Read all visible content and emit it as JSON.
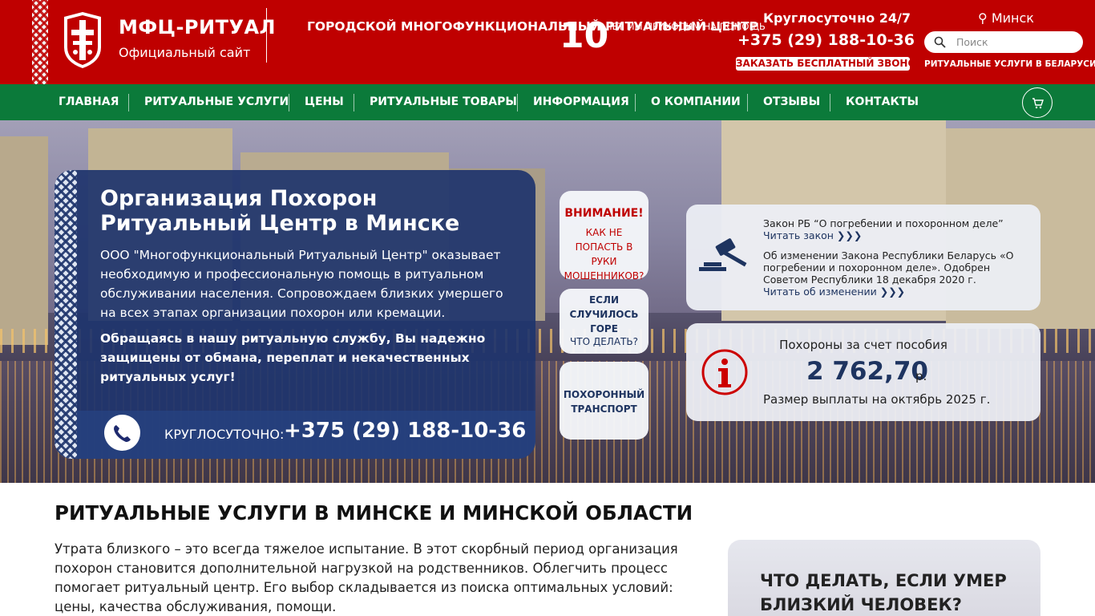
{
  "header": {
    "brand": "МФЦ-РИТУАЛ",
    "brand_sub": "Официальный сайт",
    "center_name": "ГОРОДСКОЙ МНОГОФУНКЦИОНАЛЬНЫЙ РИТУАЛЬНЫЙ ЦЕНТР",
    "years_num": "10",
    "years_text": "ЛЕТ МЫ ПРИХОДИМ НА ПОМОЩЬ",
    "hours": "Круглосуточно 24/7",
    "phone": "+375 (29) 188-10-36",
    "callback": "ЗАКАЗАТЬ БЕСПЛАТНЫЙ ЗВОНОК",
    "city": "Минск",
    "search_placeholder": "Поиск",
    "tagline": "РИТУАЛЬНЫЕ УСЛУГИ В БЕЛАРУСИ"
  },
  "nav": {
    "items": [
      "ГЛАВНАЯ",
      "РИТУАЛЬНЫЕ УСЛУГИ",
      "ЦЕНЫ",
      "РИТУАЛЬНЫЕ ТОВАРЫ",
      "ИНФОРМАЦИЯ",
      "О КОМПАНИИ",
      "ОТЗЫВЫ",
      "КОНТАКТЫ"
    ]
  },
  "hero": {
    "title": "Организация Похорон Ритуальный Центр в Минске",
    "p1": "ООО \"Многофункциональный Ритуальный Центр\" оказывает необходимую и профессиональную помощь в ритуальном обслуживании населения. Сопровождаем близких умершего на всех этапах организации похорон или кремации.",
    "p2": "Обращаясь в нашу ритуальную службу, Вы надежно защищены от обмана, переплат и некачественных ритуальных услуг!",
    "phone_label": "КРУГЛОСУТОЧНО:",
    "phone": "+375 (29) 188-10-36"
  },
  "tiles": {
    "t1_title": "ВНИМАНИЕ!",
    "t1_text": "КАК НЕ ПОПАСТЬ В РУКИ МОШЕННИКОВ?",
    "t2_title": "ЕСЛИ СЛУЧИЛОСЬ ГОРЕ",
    "t2_text": "ЧТО ДЕЛАТЬ?",
    "t3_title": "ПОХОРОННЫЙ ТРАНСПОРТ"
  },
  "law": {
    "title": "Закон РБ “О погребении и похоронном деле”",
    "link1": "Читать закон ❯❯❯",
    "change": "Об изменении Закона Республики Беларусь «О погребении и похоронном деле». Одобрен Советом Республики 18 декабря 2020 г.",
    "link2": "Читать об изменении ❯❯❯"
  },
  "benefit": {
    "title": "Похороны за счет пособия",
    "value": "2 762,70",
    "currency": "р.",
    "note": "Размер выплаты на октябрь 2025 г."
  },
  "content": {
    "heading": "РИТУАЛЬНЫЕ УСЛУГИ В МИНСКЕ И МИНСКОЙ ОБЛАСТИ",
    "text": "Утрата близкого – это всегда тяжелое испытание. В этот скорбный период организация похорон становится дополнительной нагрузкой на родственников. Облегчить процесс помогает ритуальный центр. Его выбор складывается из поиска оптимальных условий: цены, качества обслуживания, помощи.",
    "side_heading": "ЧТО ДЕЛАТЬ, ЕСЛИ УМЕР БЛИЗКИЙ ЧЕЛОВЕК?"
  },
  "colors": {
    "header_red": "#bf0000",
    "nav_green": "#0b7a3a",
    "panel_blue": "#1e346c"
  }
}
